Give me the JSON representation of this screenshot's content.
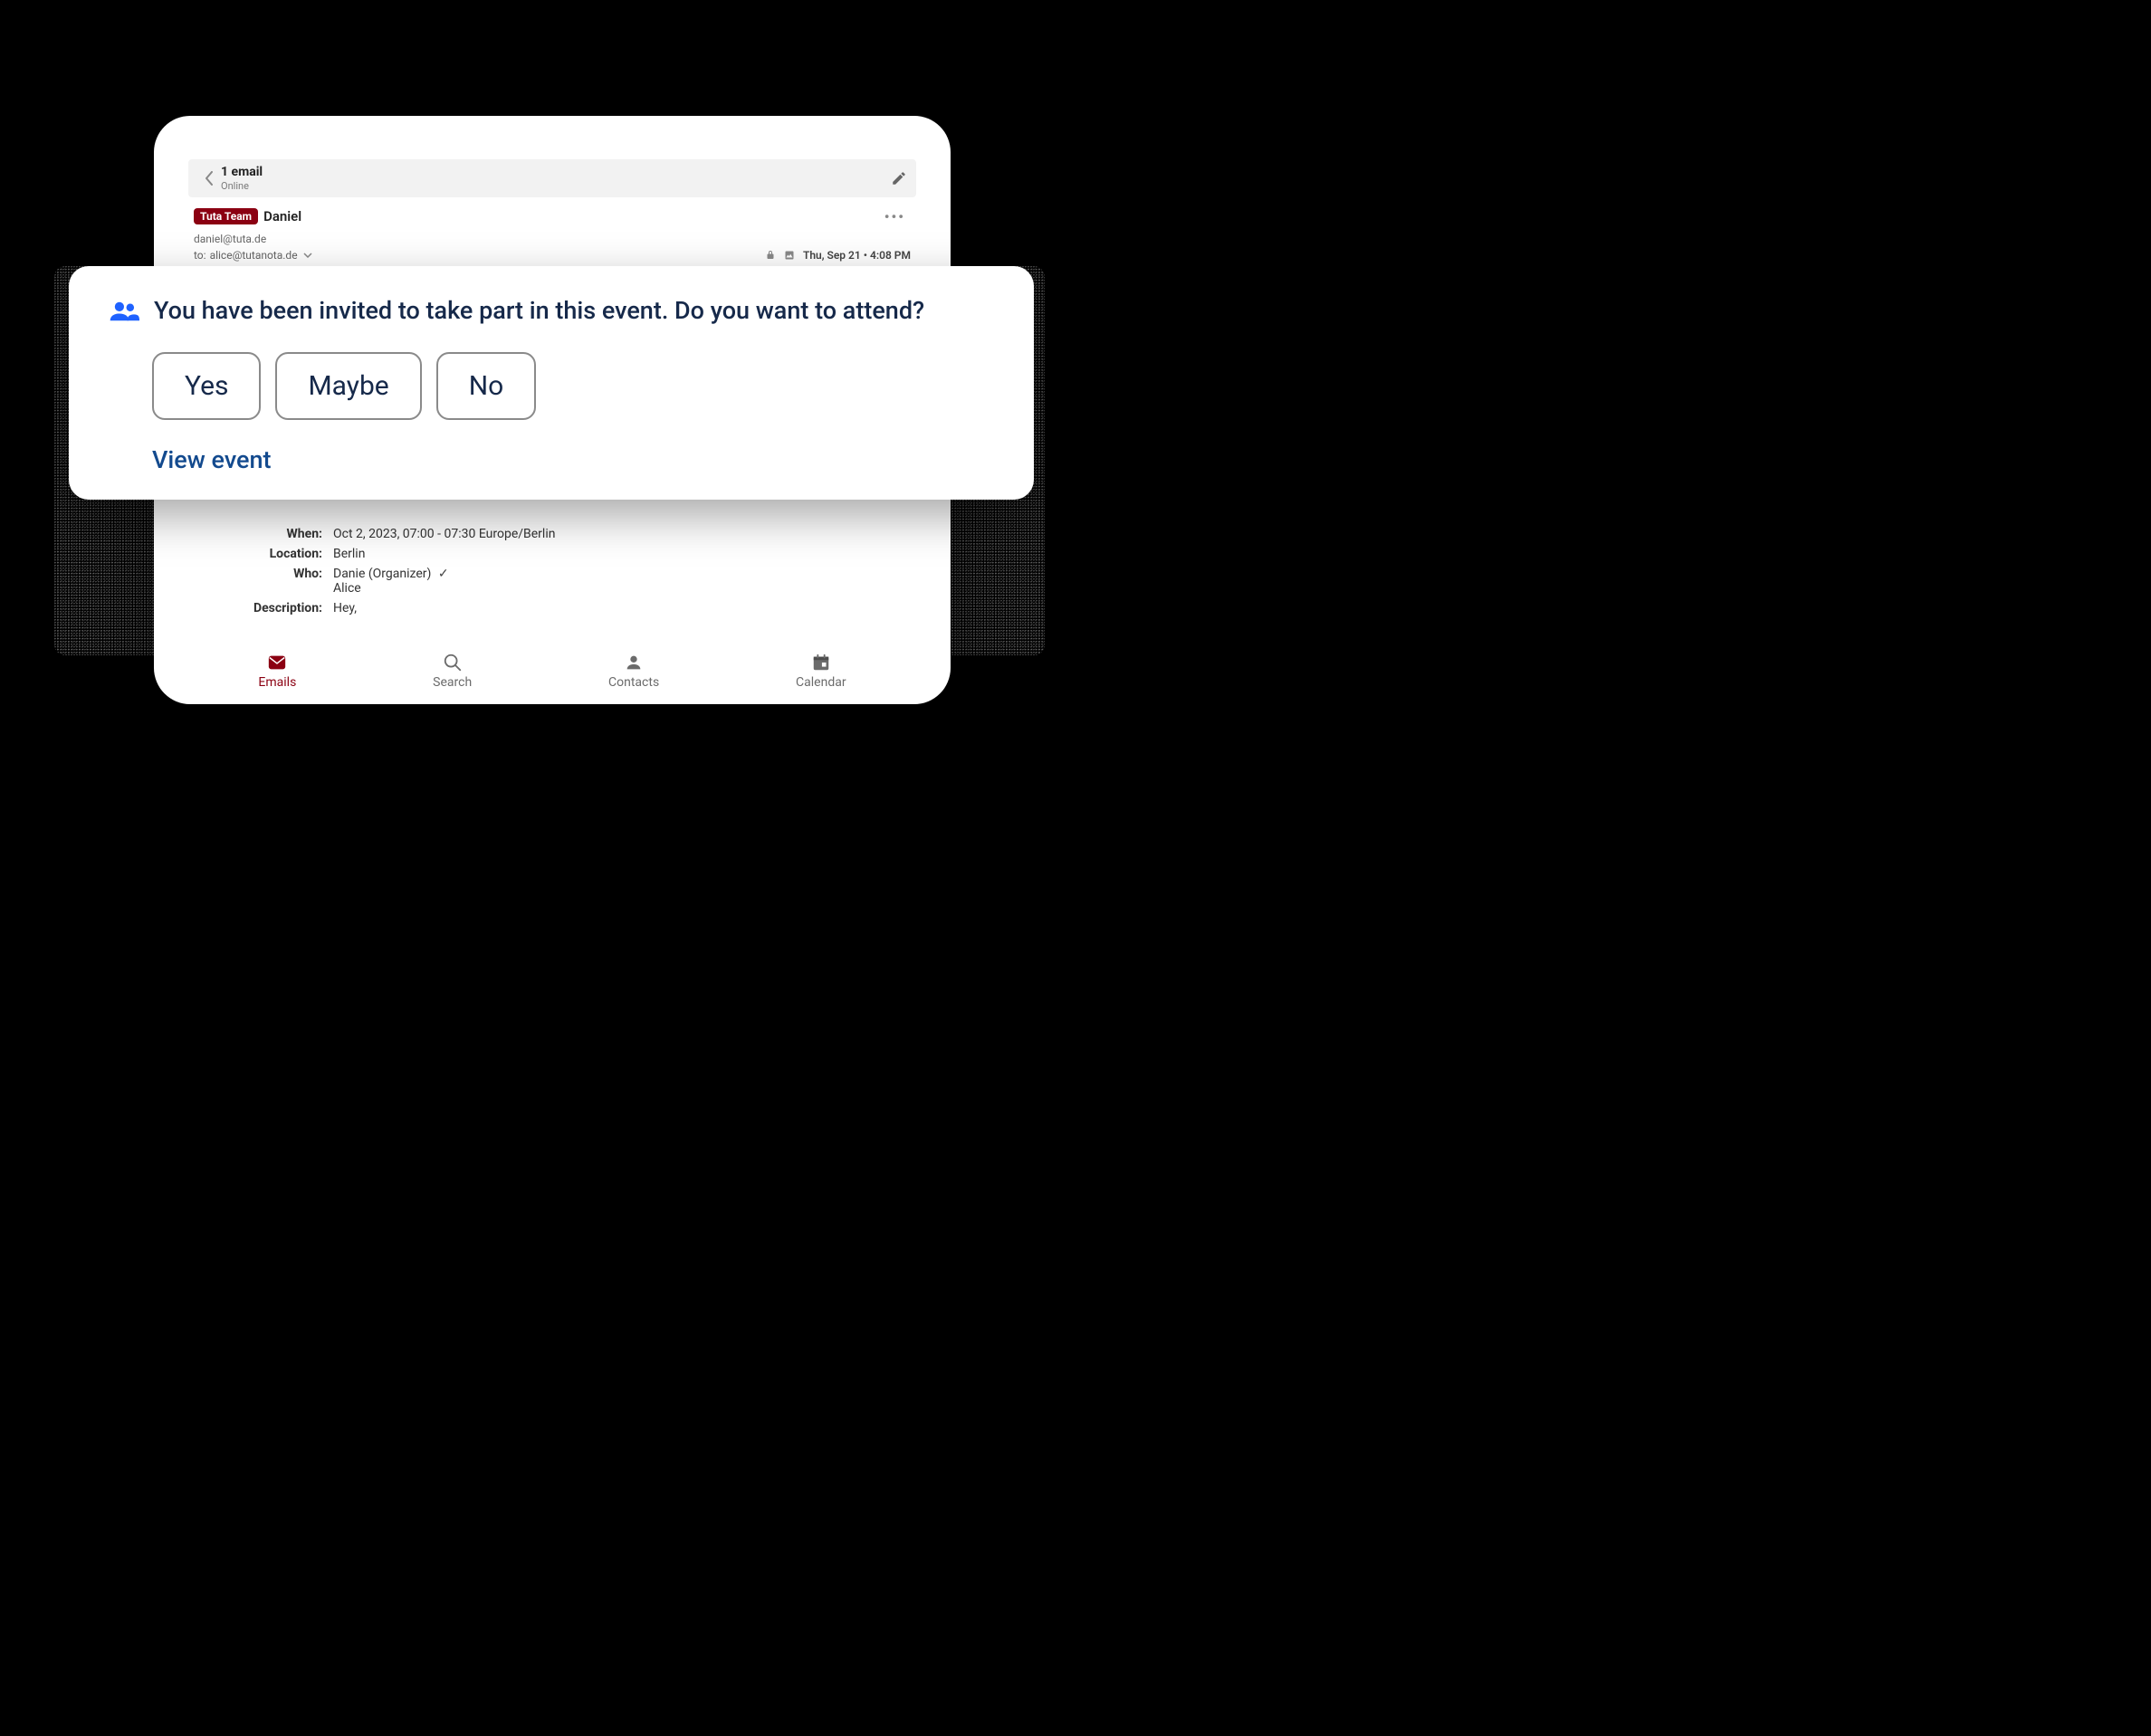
{
  "mailbar": {
    "title": "1 email",
    "subtitle": "Online"
  },
  "sender": {
    "badge": "Tuta Team",
    "name": "Daniel",
    "email": "daniel@tuta.de"
  },
  "recipient": {
    "to_label": "to:",
    "email": "alice@tutanota.de"
  },
  "meta": {
    "timestamp": "Thu, Sep 21 • 4:08 PM"
  },
  "event": {
    "labels": {
      "when": "When:",
      "location": "Location:",
      "who": "Who:",
      "description": "Description:"
    },
    "when": "Oct 2, 2023, 07:00 - 07:30 Europe/Berlin",
    "location": "Berlin",
    "who_organizer": "Danie (Organizer)",
    "who_check": "✓",
    "who_attendee": "Alice",
    "description": "Hey,"
  },
  "invite": {
    "prompt": "You have been invited to take part in this event. Do you want to attend?",
    "yes": "Yes",
    "maybe": "Maybe",
    "no": "No",
    "view_event": "View event"
  },
  "nav": {
    "emails": "Emails",
    "search": "Search",
    "contacts": "Contacts",
    "calendar": "Calendar"
  },
  "colors": {
    "accent": "#8b0012",
    "invite_text": "#16294a",
    "link": "#134a8e",
    "people_icon": "#1f62ff"
  }
}
